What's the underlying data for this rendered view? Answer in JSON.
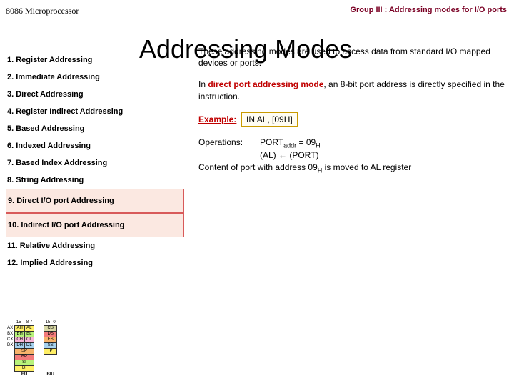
{
  "header": {
    "topic": "8086 Microprocessor",
    "group": "Group III : Addressing modes for I/O ports",
    "big_title": "Addressing Modes"
  },
  "modes": {
    "m1": "1.  Register Addressing",
    "m2": "2.  Immediate Addressing",
    "m3": "3.  Direct Addressing",
    "m4": "4.  Register Indirect Addressing",
    "m5": "5.  Based Addressing",
    "m6": "6.  Indexed Addressing",
    "m7": "7.  Based Index Addressing",
    "m8": "8.  String Addressing",
    "m9": "9.  Direct I/O port Addressing",
    "m10": "10. Indirect I/O port Addressing",
    "m11": "11. Relative Addressing",
    "m12": "12. Implied Addressing"
  },
  "body": {
    "intro": "These addressing modes are used to access data from standard I/O mapped devices or ports.",
    "direct_pre": "In ",
    "direct_term": "direct port addressing mode",
    "direct_post": ", an 8-bit port address is directly specified in the instruction.",
    "example_label": "Example:",
    "example_code": "IN AL, [09H]",
    "operations_label": "Operations:",
    "op_line1_a": "PORT",
    "op_line1_sub1": "addr",
    "op_line1_b": " = 09",
    "op_line1_sub2": "H",
    "op_line2": "(AL) ← (PORT)",
    "note_a": "Content of port with address 09",
    "note_sub": "H",
    "note_b": " is moved to AL register"
  },
  "diagram": {
    "bits_hi": "15",
    "bits_mid": "8 7",
    "bits_lo": "0",
    "ax": "AX",
    "ah": "AH",
    "al": "AL",
    "bx": "BX",
    "bh": "BH",
    "bl": "BL",
    "cx": "CX",
    "ch": "CH",
    "cl": "CL",
    "dx": "DX",
    "dh": "DH",
    "dl": "DL",
    "sp": "SP",
    "bp": "BP",
    "si": "SI",
    "di": "DI",
    "cs": "CS",
    "ds": "DS",
    "es": "ES",
    "ss": "SS",
    "ip": "IP",
    "eu": "EU",
    "biu": "BIU"
  }
}
